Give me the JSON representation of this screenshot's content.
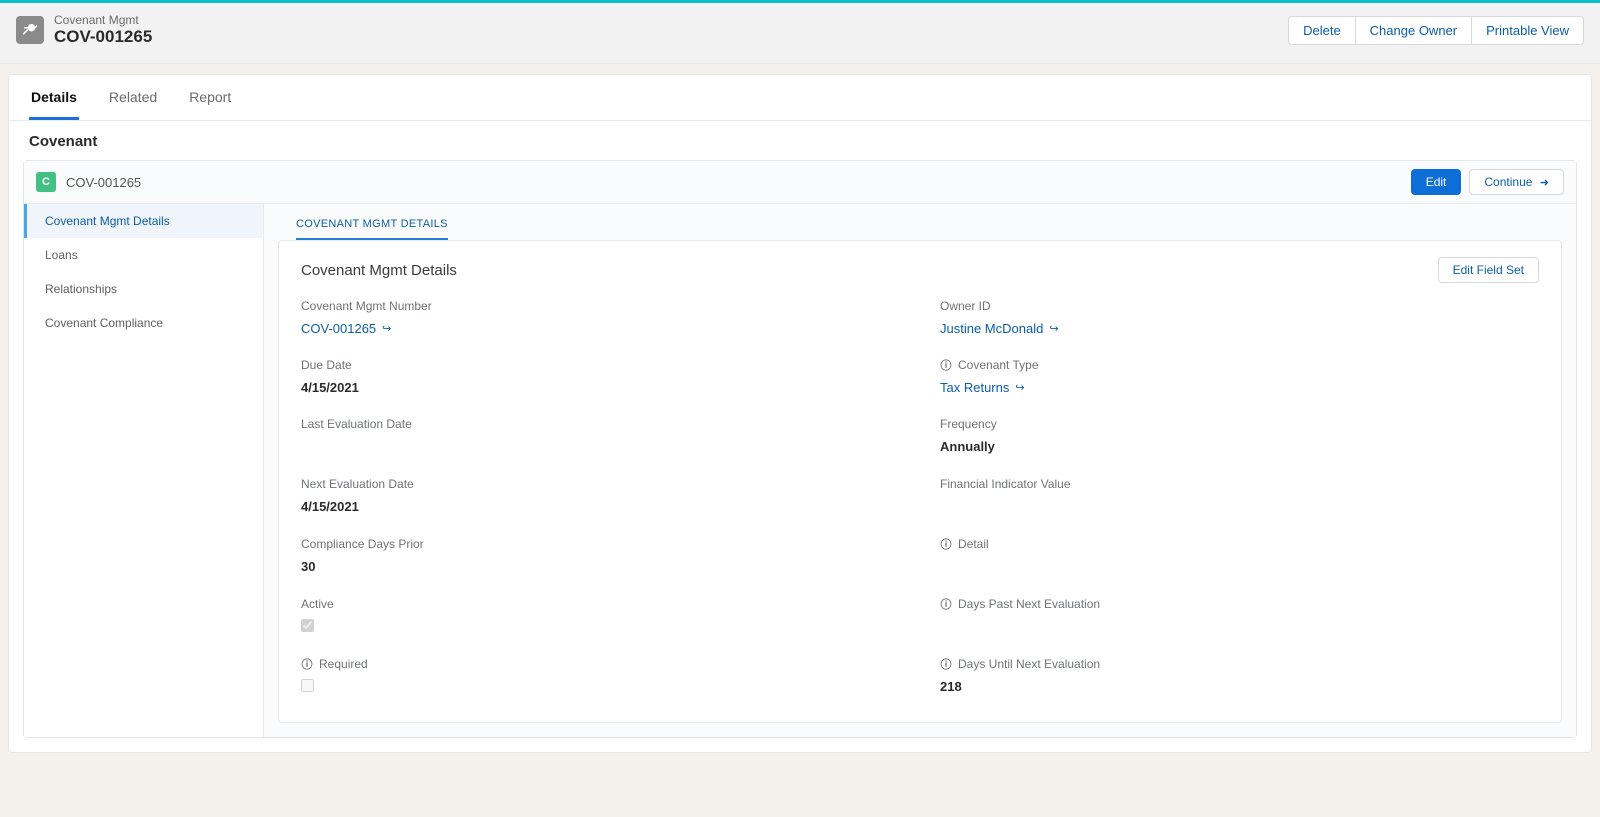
{
  "header": {
    "eyebrow": "Covenant Mgmt",
    "title": "COV-001265",
    "actions": {
      "delete": "Delete",
      "change_owner": "Change Owner",
      "printable": "Printable View"
    }
  },
  "tabs": {
    "details": "Details",
    "related": "Related",
    "report": "Report"
  },
  "section_title": "Covenant",
  "record": {
    "badge": "C",
    "id": "COV-001265",
    "edit": "Edit",
    "continue": "Continue"
  },
  "sidenav": {
    "items": [
      {
        "label": "Covenant Mgmt Details"
      },
      {
        "label": "Loans"
      },
      {
        "label": "Relationships"
      },
      {
        "label": "Covenant Compliance"
      }
    ]
  },
  "content_tab": "COVENANT MGMT DETAILS",
  "detail": {
    "title": "Covenant Mgmt Details",
    "edit_field_set": "Edit Field Set",
    "fields": {
      "cov_number": {
        "label": "Covenant Mgmt Number",
        "value": "COV-001265"
      },
      "owner": {
        "label": "Owner ID",
        "value": "Justine McDonald"
      },
      "due_date": {
        "label": "Due Date",
        "value": "4/15/2021"
      },
      "cov_type": {
        "label": "Covenant Type",
        "value": "Tax Returns"
      },
      "last_eval": {
        "label": "Last Evaluation Date",
        "value": ""
      },
      "frequency": {
        "label": "Frequency",
        "value": "Annually"
      },
      "next_eval": {
        "label": "Next Evaluation Date",
        "value": "4/15/2021"
      },
      "fin_ind": {
        "label": "Financial Indicator Value",
        "value": ""
      },
      "comp_days": {
        "label": "Compliance Days Prior",
        "value": "30"
      },
      "detail": {
        "label": "Detail",
        "value": ""
      },
      "active": {
        "label": "Active",
        "checked": true
      },
      "days_past": {
        "label": "Days Past Next Evaluation",
        "value": ""
      },
      "required": {
        "label": "Required",
        "checked": false
      },
      "days_until": {
        "label": "Days Until Next Evaluation",
        "value": "218"
      }
    }
  }
}
